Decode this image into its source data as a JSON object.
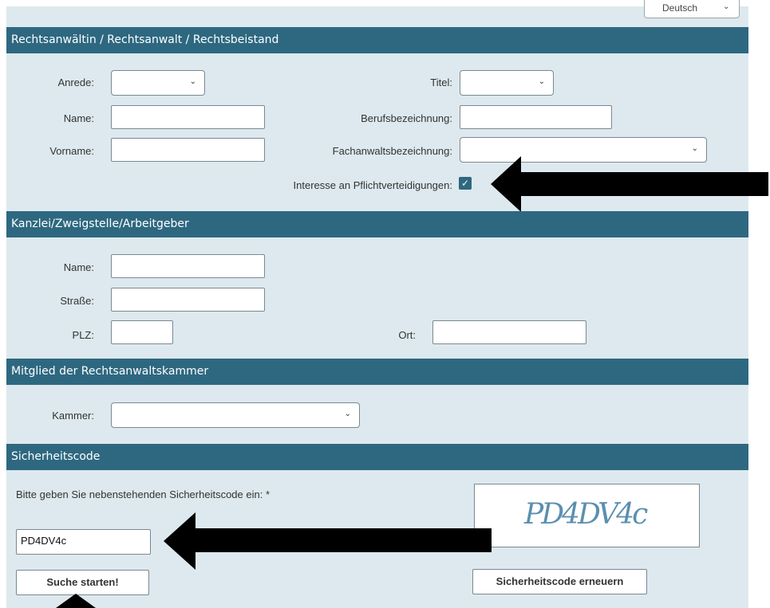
{
  "language": {
    "selected": "Deutsch"
  },
  "sections": {
    "lawyer": "Rechtsanwältin / Rechtsanwalt / Rechtsbeistand",
    "office": "Kanzlei/Zweigstelle/Arbeitgeber",
    "chamber": "Mitglied der Rechtsanwaltskammer",
    "security": "Sicherheitscode"
  },
  "lawyer": {
    "anrede_label": "Anrede:",
    "titel_label": "Titel:",
    "name_label": "Name:",
    "beruf_label": "Berufsbezeichnung:",
    "vorname_label": "Vorname:",
    "fachanwalt_label": "Fachanwaltsbezeichnung:",
    "pflicht_label": "Interesse an Pflichtverteidigungen:",
    "pflicht_checked": true
  },
  "office": {
    "name_label": "Name:",
    "strasse_label": "Straße:",
    "plz_label": "PLZ:",
    "ort_label": "Ort:"
  },
  "chamber": {
    "kammer_label": "Kammer:"
  },
  "security": {
    "prompt": "Bitte geben Sie nebenstehenden Sicherheitscode ein: *",
    "input_value": "PD4DV4c",
    "captcha_text": "PD4DV4c",
    "search_button": "Suche starten!",
    "renew_button": "Sicherheitscode erneuern"
  },
  "colors": {
    "header_bg": "#2e6880",
    "panel_bg": "#dde9ee",
    "arrow": "#000000"
  }
}
